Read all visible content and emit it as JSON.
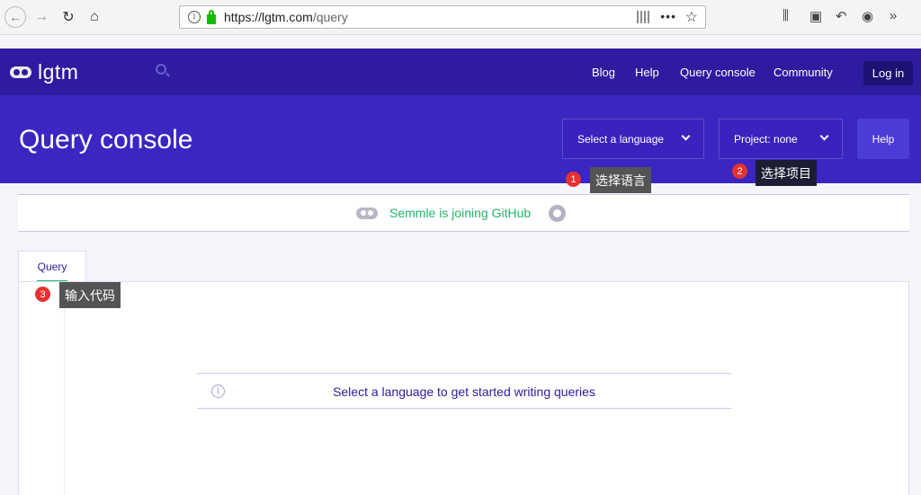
{
  "browser": {
    "url_host": "https://lgtm.com",
    "url_path": "/query",
    "back_icon": "back-icon",
    "more_icon": "more-icon"
  },
  "site_nav": {
    "logo_text": "lgtm",
    "links": [
      "Blog",
      "Help",
      "Query console",
      "Community"
    ],
    "login_label": "Log in"
  },
  "hero": {
    "title": "Query console",
    "language_dropdown": "Select a language",
    "project_dropdown": "Project: none",
    "help_label": "Help"
  },
  "announcement": {
    "text": "Semmle is joining GitHub"
  },
  "editor": {
    "tab_label": "Query",
    "notice": "Select a language to get started writing queries"
  },
  "annotations": [
    {
      "num": "1",
      "text": "选择语言"
    },
    {
      "num": "2",
      "text": "选择项目"
    },
    {
      "num": "3",
      "text": "输入代码"
    }
  ],
  "colors": {
    "nav_bg": "#2e1b9f",
    "hero_bg": "#3b26c2",
    "accent_green": "#24b36b",
    "marker_red": "#e8302e"
  }
}
